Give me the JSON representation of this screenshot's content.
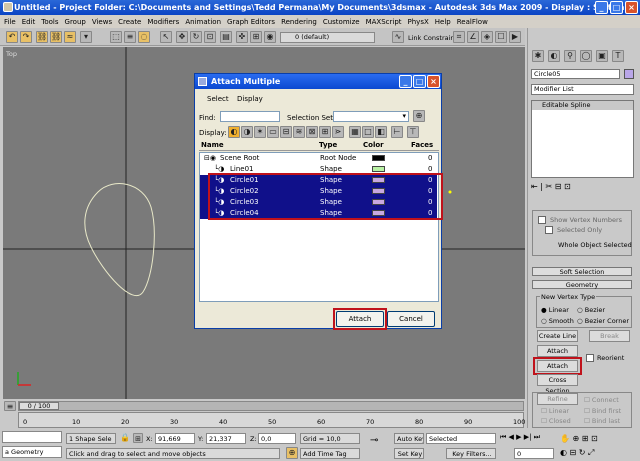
{
  "window": {
    "title": "Untitled     - Project Folder: C:\\Documents and Settings\\Tedd Permana\\My Documents\\3dsmax     - Autodesk 3ds Max  2009       - Display : Software"
  },
  "menu": [
    "File",
    "Edit",
    "Tools",
    "Group",
    "Views",
    "Create",
    "Modifiers",
    "Animation",
    "Graph Editors",
    "Rendering",
    "Customize",
    "MAXScript",
    "PhysX",
    "Help",
    "RealFlow"
  ],
  "toolbar": {
    "layer_dropdown": "0 (default)",
    "link_constrain": "Link Constrain"
  },
  "viewport": {
    "label": "Top"
  },
  "dialog": {
    "title": "Attach Multiple",
    "menu": [
      "Select",
      "Display"
    ],
    "find_label": "Find:",
    "selection_set_label": "Selection Set:",
    "display_label": "Display:",
    "columns": [
      "Name",
      "Type",
      "Color",
      "Faces"
    ],
    "rows": [
      {
        "name": "Scene Root",
        "type": "Root Node",
        "color": "#000000",
        "faces": "0",
        "selected": false,
        "indent": 0
      },
      {
        "name": "Line01",
        "type": "Shape",
        "color": "#b9f2a4",
        "faces": "0",
        "selected": false,
        "indent": 1
      },
      {
        "name": "Circle01",
        "type": "Shape",
        "color": "#c8a8e0",
        "faces": "0",
        "selected": true,
        "indent": 1
      },
      {
        "name": "Circle02",
        "type": "Shape",
        "color": "#c8a8e0",
        "faces": "0",
        "selected": true,
        "indent": 1
      },
      {
        "name": "Circle03",
        "type": "Shape",
        "color": "#c8a8e0",
        "faces": "0",
        "selected": true,
        "indent": 1
      },
      {
        "name": "Circle04",
        "type": "Shape",
        "color": "#c8a8e0",
        "faces": "0",
        "selected": true,
        "indent": 1
      }
    ],
    "attach_label": "Attach",
    "cancel_label": "Cancel"
  },
  "panel": {
    "object_name": "Circle05",
    "modifier_list": "Modifier List",
    "stack_item": "Editable Spline",
    "show_vertex_numbers": "Show Vertex Numbers",
    "selected_only": "Selected Only",
    "selection_status": "Whole Object Selected",
    "soft_selection": "Soft Selection",
    "geometry": "Geometry",
    "new_vertex_type": "New Vertex Type",
    "linear": "Linear",
    "bezier": "Bezier",
    "smooth": "Smooth",
    "bezier_corner": "Bezier Corner",
    "create_line": "Create Line",
    "break": "Break",
    "attach": "Attach",
    "reorient": "Reorient",
    "attach_mult": "Attach Mult.",
    "cross_section": "Cross Section",
    "refine": "Refine",
    "connect": "Connect",
    "linear2": "Linear",
    "bind_first": "Bind first",
    "closed": "Closed",
    "bind_last": "Bind last"
  },
  "timeline": {
    "frame": "0 / 100",
    "ticks": [
      "0",
      "10",
      "20",
      "30",
      "40",
      "50",
      "60",
      "70",
      "80",
      "90",
      "100"
    ]
  },
  "status": {
    "script": "a Geometry",
    "selection": "1 Shape Sele",
    "x_label": "X:",
    "x": "91,669",
    "y_label": "Y:",
    "y": "21,337",
    "z_label": "Z:",
    "z": "0,0",
    "grid": "Grid = 10,0",
    "prompt": "Click and drag to select and move objects",
    "add_time_tag": "Add Time Tag",
    "auto_key": "Auto Key",
    "selected": "Selected",
    "set_key": "Set Key",
    "key_filters": "Key Filters...",
    "frame_field": "0"
  }
}
